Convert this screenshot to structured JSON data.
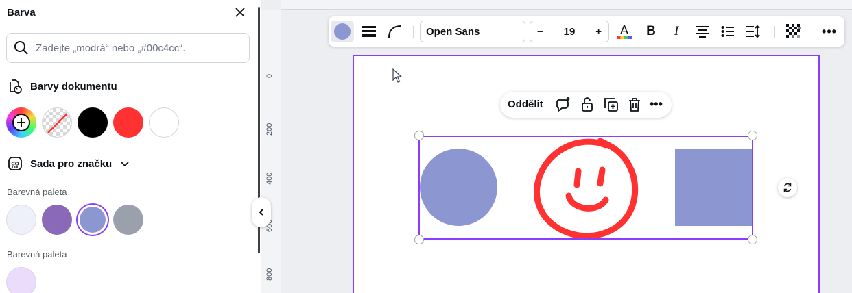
{
  "panel": {
    "title": "Barva",
    "search_placeholder": "Zadejte „modrá“ nebo „#00c4cc“.",
    "document_colors": {
      "heading": "Barvy dokumentu",
      "swatches": [
        "add-color",
        "transparent",
        "#000000",
        "#ff3131",
        "#ffffff"
      ]
    },
    "brand_kit": {
      "heading": "Sada pro značku"
    },
    "palettes": [
      {
        "label": "Barevná paleta",
        "colors": [
          "#eef0fa",
          "#8a6ab8",
          "#8c97d2",
          "#9aa1ad"
        ],
        "selected": "#8c97d2"
      },
      {
        "label": "Barevná paleta",
        "colors": [
          "#eadcfa"
        ]
      }
    ]
  },
  "ruler": {
    "labels": [
      "0",
      "200",
      "400",
      "600",
      "800"
    ]
  },
  "toolbar": {
    "fill_color": "#8c97d2",
    "font": "Open Sans",
    "size_minus": "−",
    "font_size": "19",
    "size_plus": "+",
    "text_color_letter": "A",
    "bold_label": "B",
    "italic_label": "I",
    "more_label": "•••"
  },
  "context_menu": {
    "ungroup_label": "Oddělit",
    "more_label": "•••"
  },
  "canvas": {
    "accent": "#8b3dff",
    "shape_color": "#8c97d2",
    "smiley_color": "#ff3131"
  }
}
